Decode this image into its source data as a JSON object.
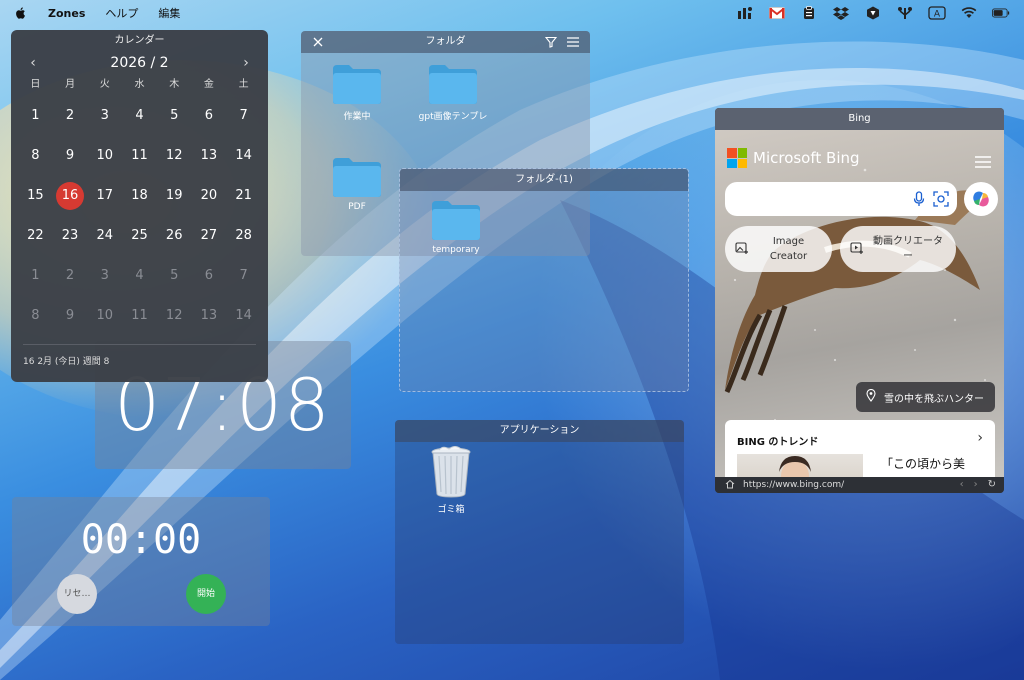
{
  "menubar": {
    "app_name": "Zones",
    "menus": [
      "ヘルプ",
      "編集"
    ]
  },
  "calendar": {
    "title": "カレンダー",
    "month": "2026 / 2",
    "weekdays": [
      "日",
      "月",
      "火",
      "水",
      "木",
      "金",
      "土"
    ],
    "weeks": [
      [
        "1",
        "2",
        "3",
        "4",
        "5",
        "6",
        "7"
      ],
      [
        "8",
        "9",
        "10",
        "11",
        "12",
        "13",
        "14"
      ],
      [
        "15",
        "16",
        "17",
        "18",
        "19",
        "20",
        "21"
      ],
      [
        "22",
        "23",
        "24",
        "25",
        "26",
        "27",
        "28"
      ],
      [
        "1",
        "2",
        "3",
        "4",
        "5",
        "6",
        "7"
      ],
      [
        "8",
        "9",
        "10",
        "11",
        "12",
        "13",
        "14"
      ]
    ],
    "today": "16",
    "footer": "16 2月 (今日) 週間 8"
  },
  "clock": {
    "time": "07:08"
  },
  "timer": {
    "time": "00:00",
    "reset_label": "リセ…",
    "start_label": "開始"
  },
  "folder_window": {
    "title": "フォルダ",
    "items": [
      "作業中",
      "gpt画像テンプレ",
      "PDF"
    ]
  },
  "folder_window_2": {
    "title": "フォルダ-(1)",
    "items": [
      "temporary"
    ]
  },
  "apps_window": {
    "title": "アプリケーション",
    "items": [
      "ゴミ箱"
    ]
  },
  "bing": {
    "title": "Bing",
    "brand": "Microsoft Bing",
    "chip_image_creator": "Image Creator",
    "chip_video_creator": "動画クリエーター",
    "location": "雪の中を飛ぶハンター",
    "trend_title": "BING のトレンド",
    "trend_text": "「この頃から美",
    "url": "https://www.bing.com/"
  },
  "colors": {
    "today": "#d63a32",
    "start_button": "#34b256",
    "folder": "#5ab7ee"
  }
}
